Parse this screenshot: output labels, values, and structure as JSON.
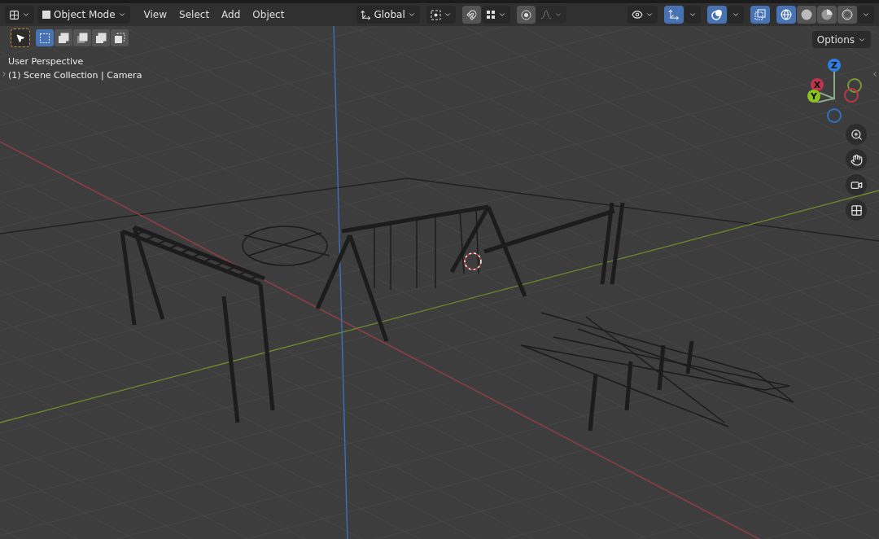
{
  "header": {
    "mode": "Object Mode",
    "menus": [
      "View",
      "Select",
      "Add",
      "Object"
    ],
    "orientation": "Global",
    "toggles": [
      {
        "kind": "gizmo",
        "on": true
      },
      {
        "kind": "overlay",
        "on": true
      },
      {
        "kind": "xray",
        "on": true
      }
    ],
    "shading": [
      {
        "kind": "wireframe",
        "selected": true
      },
      {
        "kind": "solid",
        "selected": false
      },
      {
        "kind": "material",
        "selected": false
      },
      {
        "kind": "rendered",
        "selected": false
      }
    ]
  },
  "tool_row": {
    "select_modes": [
      {
        "selected": true
      },
      {
        "selected": false
      },
      {
        "selected": false
      },
      {
        "selected": false
      },
      {
        "selected": false
      }
    ],
    "options": "Options"
  },
  "viewport": {
    "view_name": "User Perspective",
    "collection": "(1) Scene Collection | Camera",
    "axes": [
      {
        "label": "Z",
        "color": "#2f7fe0"
      },
      {
        "label": "X",
        "color": "#c0354b"
      },
      {
        "label": "Y",
        "color": "#8bc31f"
      }
    ]
  }
}
